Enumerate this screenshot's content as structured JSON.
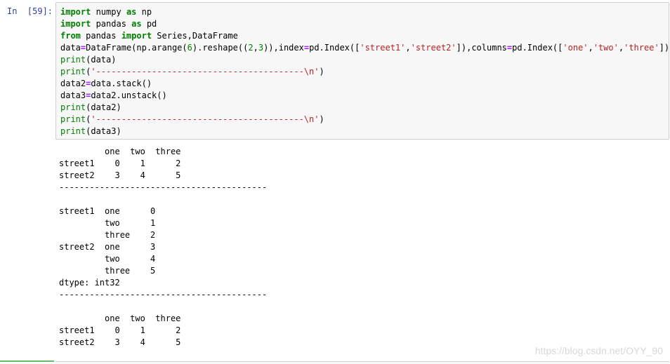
{
  "cell": {
    "prompt": "In  [59]:"
  },
  "code_lines": [
    [
      {
        "t": "import",
        "c": "kw"
      },
      {
        "t": " numpy ",
        "c": ""
      },
      {
        "t": "as",
        "c": "kw"
      },
      {
        "t": " np",
        "c": ""
      }
    ],
    [
      {
        "t": "import",
        "c": "kw"
      },
      {
        "t": " pandas ",
        "c": ""
      },
      {
        "t": "as",
        "c": "kw"
      },
      {
        "t": " pd",
        "c": ""
      }
    ],
    [
      {
        "t": "from",
        "c": "kw"
      },
      {
        "t": " pandas ",
        "c": ""
      },
      {
        "t": "import",
        "c": "kw"
      },
      {
        "t": " Series,DataFrame",
        "c": ""
      }
    ],
    [
      {
        "t": "data",
        "c": ""
      },
      {
        "t": "=",
        "c": "op"
      },
      {
        "t": "DataFrame(np.arange(",
        "c": ""
      },
      {
        "t": "6",
        "c": "num"
      },
      {
        "t": ").reshape((",
        "c": ""
      },
      {
        "t": "2",
        "c": "num"
      },
      {
        "t": ",",
        "c": ""
      },
      {
        "t": "3",
        "c": "num"
      },
      {
        "t": ")),index",
        "c": ""
      },
      {
        "t": "=",
        "c": "op"
      },
      {
        "t": "pd.Index([",
        "c": ""
      },
      {
        "t": "'street1'",
        "c": "str"
      },
      {
        "t": ",",
        "c": ""
      },
      {
        "t": "'street2'",
        "c": "str"
      },
      {
        "t": "]),columns",
        "c": ""
      },
      {
        "t": "=",
        "c": "op"
      },
      {
        "t": "pd.Index([",
        "c": ""
      },
      {
        "t": "'one'",
        "c": "str"
      },
      {
        "t": ",",
        "c": ""
      },
      {
        "t": "'two'",
        "c": "str"
      },
      {
        "t": ",",
        "c": ""
      },
      {
        "t": "'three'",
        "c": "str"
      },
      {
        "t": "]))",
        "c": ""
      }
    ],
    [
      {
        "t": "print",
        "c": "fn"
      },
      {
        "t": "(data)",
        "c": ""
      }
    ],
    [
      {
        "t": "print",
        "c": "fn"
      },
      {
        "t": "(",
        "c": ""
      },
      {
        "t": "'-----------------------------------------\\n'",
        "c": "str"
      },
      {
        "t": ")",
        "c": ""
      }
    ],
    [
      {
        "t": "data2",
        "c": ""
      },
      {
        "t": "=",
        "c": "op"
      },
      {
        "t": "data.stack()",
        "c": ""
      }
    ],
    [
      {
        "t": "data3",
        "c": ""
      },
      {
        "t": "=",
        "c": "op"
      },
      {
        "t": "data2.unstack()",
        "c": ""
      }
    ],
    [
      {
        "t": "print",
        "c": "fn"
      },
      {
        "t": "(data2)",
        "c": ""
      }
    ],
    [
      {
        "t": "print",
        "c": "fn"
      },
      {
        "t": "(",
        "c": ""
      },
      {
        "t": "'-----------------------------------------\\n'",
        "c": "str"
      },
      {
        "t": ")",
        "c": ""
      }
    ],
    [
      {
        "t": "print",
        "c": "fn"
      },
      {
        "t": "(data3)",
        "c": ""
      }
    ]
  ],
  "output_lines": [
    "         one  two  three",
    "street1    0    1      2",
    "street2    3    4      5",
    "-----------------------------------------",
    "",
    "street1  one      0",
    "         two      1",
    "         three    2",
    "street2  one      3",
    "         two      4",
    "         three    5",
    "dtype: int32",
    "-----------------------------------------",
    "",
    "         one  two  three",
    "street1    0    1      2",
    "street2    3    4      5"
  ],
  "watermark": "https://blog.csdn.net/OYY_90",
  "colors": {
    "prompt": "#303f9f",
    "keyword": "#008000",
    "string": "#ba2121",
    "operator": "#aa22ff",
    "cell_bg": "#f7f7f7",
    "cell_border": "#cfcfcf"
  }
}
